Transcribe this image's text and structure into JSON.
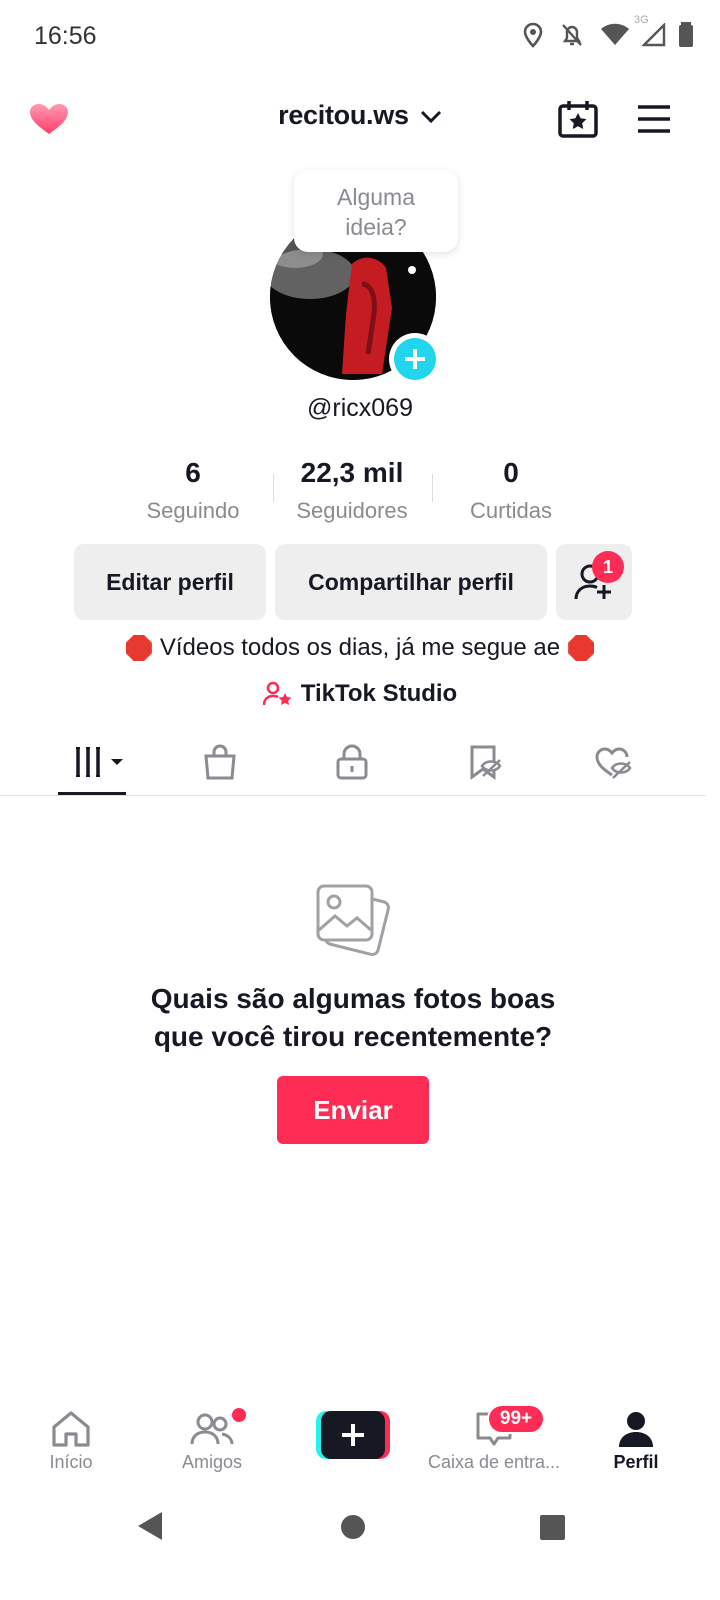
{
  "status_bar": {
    "time": "16:56",
    "network": "3G"
  },
  "header": {
    "username": "recitou.ws"
  },
  "tooltip": {
    "line1": "Alguma",
    "line2": "ideia?"
  },
  "profile": {
    "handle": "@ricx069"
  },
  "stats": [
    {
      "value": "6",
      "label": "Seguindo"
    },
    {
      "value": "22,3 mil",
      "label": "Seguidores"
    },
    {
      "value": "0",
      "label": "Curtidas"
    }
  ],
  "actions": {
    "edit": "Editar perfil",
    "share": "Compartilhar perfil",
    "add_friend_badge": "1"
  },
  "bio": "Vídeos todos os dias, já me segue ae",
  "studio_link": "TikTok Studio",
  "empty_state": {
    "line1": "Quais são algumas fotos boas",
    "line2": "que você tirou recentemente?",
    "button": "Enviar"
  },
  "bottom_nav": {
    "home": "Início",
    "friends": "Amigos",
    "inbox": "Caixa de entra...",
    "inbox_badge": "99+",
    "profile": "Perfil"
  },
  "colors": {
    "accent": "#fe2c55",
    "cyan": "#25f4ee",
    "plus_badge": "#20d5ec"
  }
}
